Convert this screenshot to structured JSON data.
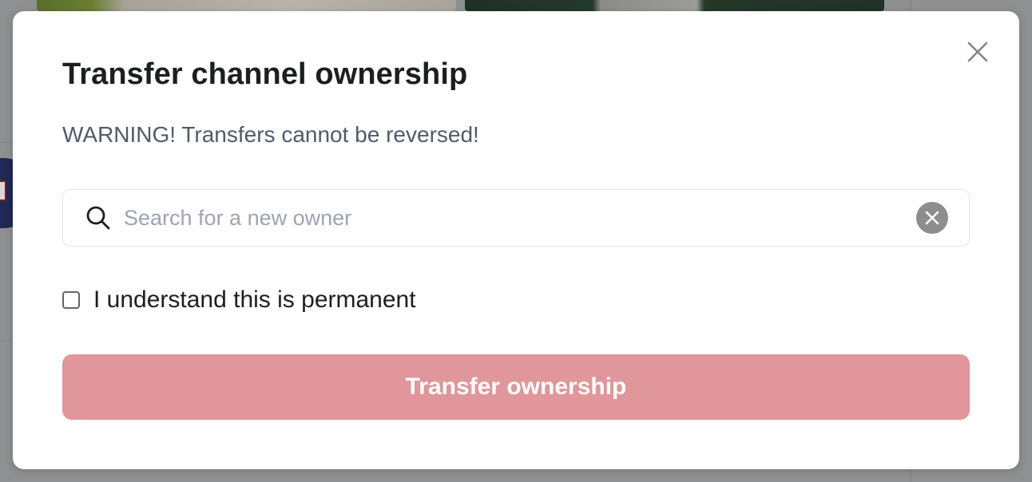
{
  "modal": {
    "title": "Transfer channel ownership",
    "warning": "WARNING! Transfers cannot be reversed!",
    "close_icon": "close-icon",
    "search": {
      "placeholder": "Search for a new owner",
      "value": "",
      "icon": "search-icon",
      "clear_icon": "clear-icon"
    },
    "confirm": {
      "label": "I understand this is permanent",
      "checked": false
    },
    "submit": {
      "label": "Transfer ownership",
      "enabled": false
    }
  },
  "colors": {
    "overlay_background": "#8f9091",
    "modal_background": "#ffffff",
    "title_text": "#1c1e21",
    "warning_text": "#4e5b6d",
    "button_disabled_background": "#e0969a",
    "button_text": "#ffffff",
    "clear_button_background": "#8d8d8d"
  }
}
